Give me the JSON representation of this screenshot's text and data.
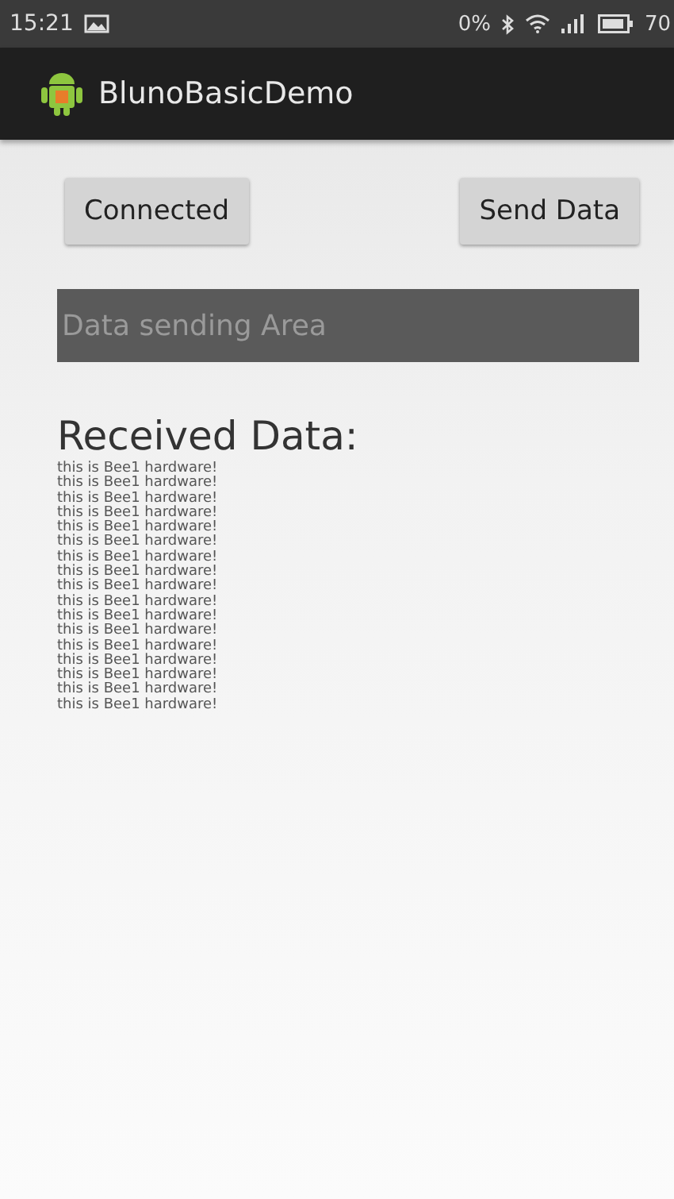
{
  "status_bar": {
    "time": "15:21",
    "net_speed": "0%",
    "battery": "70"
  },
  "app_bar": {
    "title": "BlunoBasicDemo"
  },
  "buttons": [
    {
      "label": "Connected"
    },
    {
      "label": "Send Data"
    }
  ],
  "input": {
    "placeholder": "Data sending Area"
  },
  "received": {
    "heading": "Received Data:",
    "lines": [
      "this is Bee1 hardware!",
      "this is Bee1 hardware!",
      "this is Bee1 hardware!",
      "this is Bee1 hardware!",
      "this is Bee1 hardware!",
      "this is Bee1 hardware!",
      "this is Bee1 hardware!",
      "this is Bee1 hardware!",
      "this is Bee1 hardware!",
      "this is Bee1 hardware!",
      "this is Bee1 hardware!",
      "this is Bee1 hardware!",
      "this is Bee1 hardware!",
      "this is Bee1 hardware!",
      "this is Bee1 hardware!",
      "this is Bee1 hardware!",
      "this is Bee1 hardware!"
    ]
  }
}
